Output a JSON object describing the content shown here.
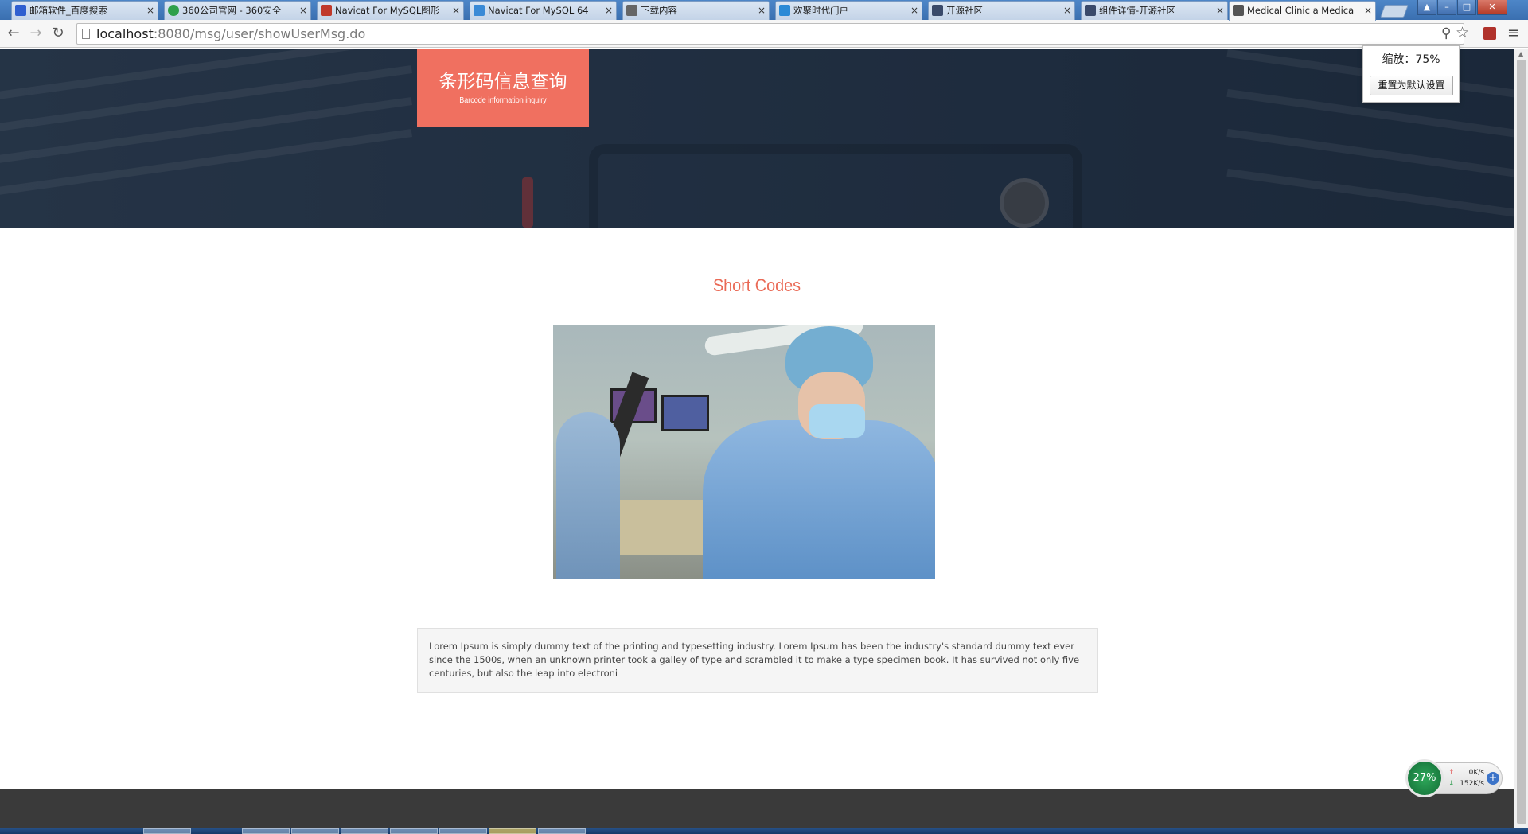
{
  "browser": {
    "tabs": [
      {
        "title": "邮箱软件_百度搜索",
        "favicon_color": "#2f5fd0"
      },
      {
        "title": "360公司官网 - 360安全",
        "favicon_color": "#2fa04a"
      },
      {
        "title": "Navicat For MySQL图形",
        "favicon_color": "#c0392b"
      },
      {
        "title": "Navicat For MySQL 64",
        "favicon_color": "#3a8ad6"
      },
      {
        "title": "下载内容",
        "favicon_color": "#666666"
      },
      {
        "title": "欢聚时代门户",
        "favicon_color": "#2a8ad6"
      },
      {
        "title": "开源社区",
        "favicon_color": "#3a4a6a"
      },
      {
        "title": "组件详情-开源社区",
        "favicon_color": "#3a4a6a"
      },
      {
        "title": "Medical Clinic a Medica",
        "favicon_color": "#555555",
        "active": true
      }
    ],
    "close_glyph": "×",
    "nav": {
      "back": "←",
      "forward": "→",
      "reload": "↻"
    },
    "url_host": "localhost",
    "url_path": ":8080/msg/user/showUserMsg.do",
    "icons": [
      "zoom-icon",
      "star-icon",
      "pdf-extension-icon",
      "menu-icon"
    ],
    "zoom_glyph": "⚲",
    "star_glyph": "☆",
    "menu_glyph": "≡",
    "window_buttons": {
      "user": "▲",
      "minimize": "–",
      "maximize": "□",
      "close": "✕"
    }
  },
  "zoom_bubble": {
    "text": "缩放：75%",
    "reset_label": "重置为默认设置"
  },
  "page": {
    "brand_title": "条形码信息查询",
    "brand_subtitle": "Barcode information inquiry",
    "section_title": "Short Codes",
    "body_text": "Lorem Ipsum is simply dummy text of the printing and typesetting industry. Lorem Ipsum has been the industry's standard dummy text ever since the 1500s, when an unknown printer took a galley of type and scrambled it to make a type specimen book. It has survived not only five centuries, but also the leap into electroni"
  },
  "speed_widget": {
    "percent": "27%",
    "upload": "0K/s",
    "download": "152K/s",
    "up_arrow": "↑",
    "down_arrow": "↓",
    "plus": "+"
  },
  "colors": {
    "accent": "#f07060",
    "section_title": "#ea6a56",
    "footer": "#3a3a3a"
  }
}
